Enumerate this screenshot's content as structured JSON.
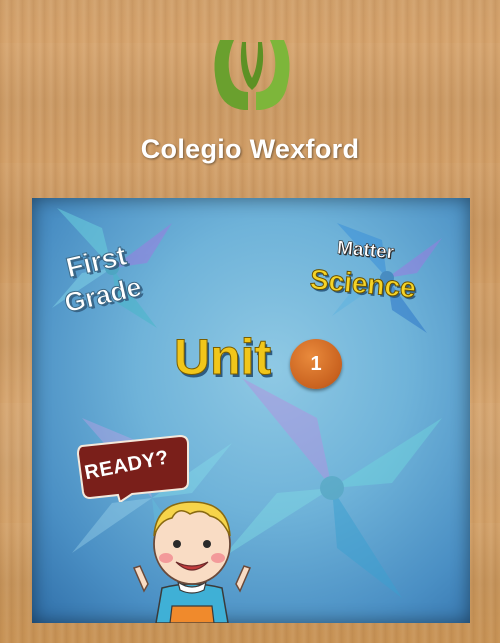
{
  "header": {
    "logo_icon": "colegio-wexford-logo",
    "school_name": "Colegio Wexford"
  },
  "cover": {
    "grade": {
      "line1": "First",
      "line2": "Grade"
    },
    "subject": {
      "topic": "Matter",
      "area": "Science"
    },
    "unit": {
      "label": "Unit",
      "number": "1"
    },
    "prompt": "READY?",
    "illustration": "smiling-boy-illustration",
    "background_icon": "pinwheel-icon"
  },
  "colors": {
    "wood": "#d7a56e",
    "sky": "#6fb3d9",
    "logo_green": "#6aa02e",
    "unit_yellow": "#f1c61a",
    "badge_orange": "#d2692a",
    "ready_bubble": "#7a1f1a"
  }
}
